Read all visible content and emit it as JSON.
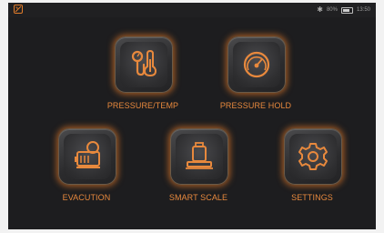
{
  "status": {
    "battery": "80%",
    "time": "13:50",
    "battery_level": 0.8,
    "icons": [
      "app-logo-icon",
      "bluetooth-icon",
      "battery-icon"
    ]
  },
  "menu": {
    "pressure_temp": {
      "label": "PRESSURE/TEMP",
      "icon": "gauge-thermometer-icon"
    },
    "pressure_hold": {
      "label": "PRESSURE HOLD",
      "icon": "pressure-gauge-icon"
    },
    "evacuation": {
      "label": "EVACUTION",
      "icon": "vacuum-pump-icon"
    },
    "smart_scale": {
      "label": "SMART SCALE",
      "icon": "scale-icon"
    },
    "settings": {
      "label": "SETTINGS",
      "icon": "gear-icon"
    }
  },
  "colors": {
    "accent": "#e8893d",
    "background": "#1d1d1f",
    "tile": "#3a3a3c"
  }
}
